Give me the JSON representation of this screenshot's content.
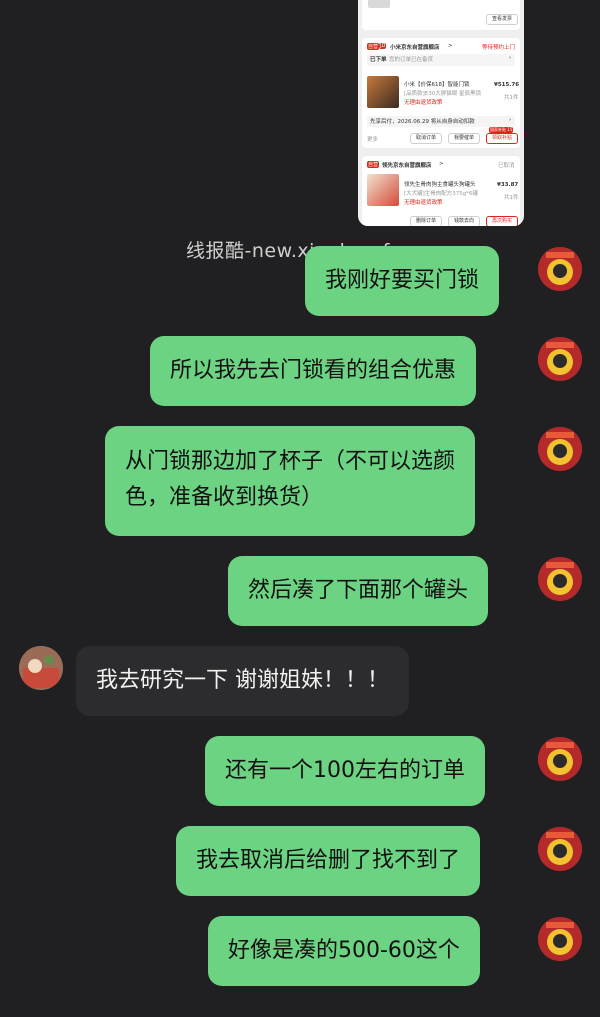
{
  "watermark": "线报酷-new.xianbao.fun",
  "order_screenshot": {
    "top_button": "查看发票",
    "store1": {
      "badge": "自营",
      "name": "小米京东自营旗舰店",
      "chevron": ">",
      "status": "等待预约上门",
      "placed_label": "已下单",
      "placed_sub": "您的订单已在备货",
      "product": "小米【价保618】智能门锁",
      "product_sub": "[品质款]E30大屏猫眼 星辰黑锁",
      "service": "无理由退货政策",
      "price": "¥515.76",
      "qty": "共1件",
      "payment_note": "先享后付，2026.06.29 将从自身自动扣款",
      "more": "更多",
      "buttons": [
        "取消订单",
        "我要催单",
        "领取补贴"
      ],
      "corner_badge": "国家补贴 15"
    },
    "store2": {
      "badge": "自营",
      "name": "领先京东自营旗舰店",
      "chevron": ">",
      "status": "已取消",
      "product": "领先生骨肉狗主食罐头狗罐头",
      "product_sub": "[大犬罐]生骨肉配方375g*6罐",
      "service": "无理由退货政策",
      "price": "¥33.87",
      "qty": "共1件",
      "buttons": [
        "删除订单",
        "钱款去向",
        "再次购买"
      ]
    }
  },
  "messages": [
    {
      "side": "out",
      "text": "我刚好要买门锁"
    },
    {
      "side": "out",
      "text": "所以我先去门锁看的组合优惠"
    },
    {
      "side": "out",
      "line1": "从门锁那边加了杯子（不可以选颜",
      "line2": "色，准备收到换货）"
    },
    {
      "side": "out",
      "text": "然后凑了下面那个罐头"
    },
    {
      "side": "in",
      "text": "我去研究一下 谢谢姐妹！！！"
    },
    {
      "side": "out",
      "text": "还有一个100左右的订单"
    },
    {
      "side": "out",
      "text": "我去取消后给删了找不到了"
    },
    {
      "side": "out",
      "text": "好像是凑的500-60这个"
    }
  ],
  "colors": {
    "background": "#202022",
    "outgoing_bubble": "#6cd383",
    "incoming_bubble": "#2c2c2e"
  }
}
